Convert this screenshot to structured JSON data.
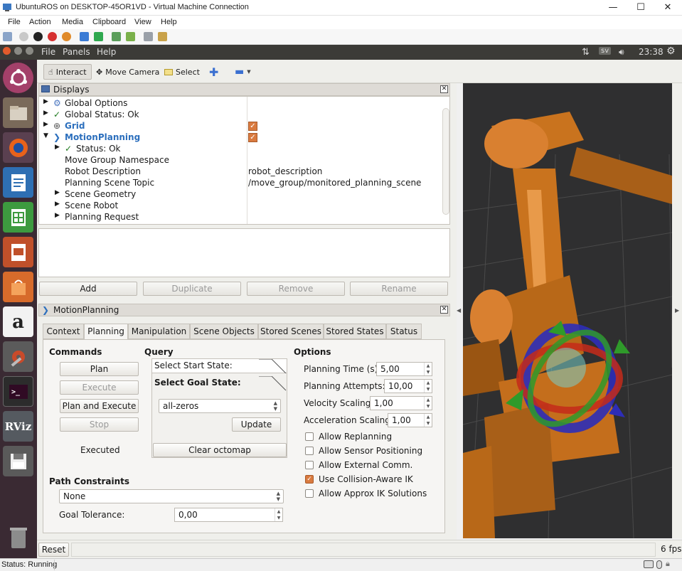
{
  "window": {
    "title": "UbuntuROS on DESKTOP-45OR1VD - Virtual Machine Connection",
    "minimize": "—",
    "maximize": "☐",
    "close": "✕"
  },
  "vm_menu": [
    "File",
    "Action",
    "Media",
    "Clipboard",
    "View",
    "Help"
  ],
  "ubuntu_bar": {
    "menus": [
      "File",
      "Panels",
      "Help"
    ],
    "clock": "23:38",
    "keyboard": "sv"
  },
  "launcher": [
    "ubuntu-icon",
    "files-icon",
    "firefox-icon",
    "writer-icon",
    "calc-icon",
    "impress-icon",
    "software-center-icon",
    "amazon-icon",
    "system-settings-icon",
    "terminal-icon",
    "rviz-icon",
    "save-icon",
    "trash-icon"
  ],
  "launcher_labels": {
    "rviz": "RViz",
    "amazon": "a"
  },
  "rviz_toolbar": {
    "interact": "Interact",
    "move_camera": "Move Camera",
    "select": "Select"
  },
  "displays": {
    "title": "Displays",
    "rows": [
      {
        "key": "Global Options",
        "value": ""
      },
      {
        "key": "Global Status: Ok",
        "value": ""
      },
      {
        "key": "Grid",
        "value": ""
      },
      {
        "key": "MotionPlanning",
        "value": ""
      },
      {
        "key": "Status: Ok",
        "value": ""
      },
      {
        "key": "Move Group Namespace",
        "value": ""
      },
      {
        "key": "Robot Description",
        "value": "robot_description"
      },
      {
        "key": "Planning Scene Topic",
        "value": "/move_group/monitored_planning_scene"
      },
      {
        "key": "Scene Geometry",
        "value": ""
      },
      {
        "key": "Scene Robot",
        "value": ""
      },
      {
        "key": "Planning Request",
        "value": ""
      }
    ],
    "buttons": {
      "add": "Add",
      "duplicate": "Duplicate",
      "remove": "Remove",
      "rename": "Rename"
    }
  },
  "motion_planning": {
    "title": "MotionPlanning",
    "tabs": [
      "Context",
      "Planning",
      "Manipulation",
      "Scene Objects",
      "Stored Scenes",
      "Stored States",
      "Status"
    ],
    "commands": {
      "header": "Commands",
      "plan": "Plan",
      "execute": "Execute",
      "plan_and_execute": "Plan and Execute",
      "stop": "Stop",
      "result": "Executed"
    },
    "query": {
      "header": "Query",
      "start": "Select Start State:",
      "goal": "Select Goal State:",
      "goal_value": "all-zeros",
      "update": "Update",
      "clear": "Clear octomap"
    },
    "options": {
      "header": "Options",
      "planning_time_label": "Planning Time (s):",
      "planning_time": "5,00",
      "attempts_label": "Planning Attempts:",
      "attempts": "10,00",
      "velocity_label": "Velocity Scaling:",
      "velocity": "1,00",
      "accel_label": "Acceleration Scaling:",
      "accel": "1,00",
      "checks": [
        {
          "label": "Allow Replanning",
          "checked": false
        },
        {
          "label": "Allow Sensor Positioning",
          "checked": false
        },
        {
          "label": "Allow External Comm.",
          "checked": false
        },
        {
          "label": "Use Collision-Aware IK",
          "checked": true
        },
        {
          "label": "Allow Approx IK Solutions",
          "checked": false
        }
      ]
    },
    "path": {
      "header": "Path Constraints",
      "value": "None",
      "tolerance_label": "Goal Tolerance:",
      "tolerance": "0,00"
    }
  },
  "bottom": {
    "reset": "Reset",
    "fps": "6 fps"
  },
  "status": {
    "text": "Status: Running"
  },
  "colors": {
    "accent": "#d97a3f",
    "robot": "#c9731e",
    "ubuntu_bar": "#3c3b37",
    "launcher": "#3a2a33"
  }
}
